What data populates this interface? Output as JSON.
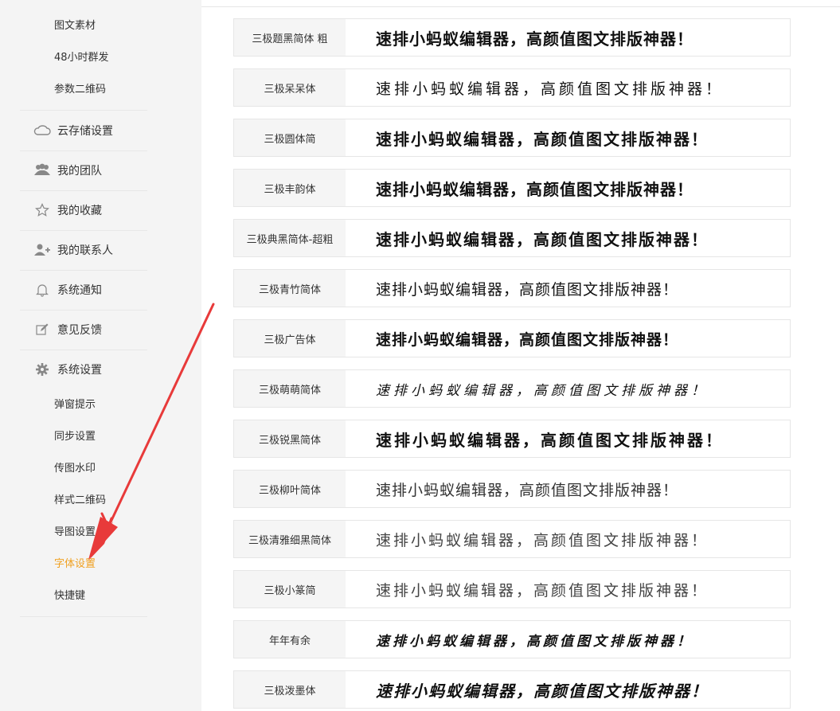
{
  "sidebar": {
    "sub_top": [
      "图文素材",
      "48小时群发",
      "参数二维码"
    ],
    "menu": [
      {
        "label": "云存储设置",
        "icon": "cloud-icon"
      },
      {
        "label": "我的团队",
        "icon": "team-icon"
      },
      {
        "label": "我的收藏",
        "icon": "star-icon"
      },
      {
        "label": "我的联系人",
        "icon": "add-contact-icon"
      },
      {
        "label": "系统通知",
        "icon": "bell-icon"
      },
      {
        "label": "意见反馈",
        "icon": "edit-icon"
      },
      {
        "label": "系统设置",
        "icon": "gear-icon"
      }
    ],
    "settings_items": [
      "弹窗提示",
      "同步设置",
      "传图水印",
      "样式二维码",
      "导图设置",
      "字体设置",
      "快捷键"
    ],
    "active_item": "字体设置"
  },
  "fonts": [
    {
      "name": "三极题黑简体 粗",
      "sample": "速排小蚂蚁编辑器，高颜值图文排版神器！"
    },
    {
      "name": "三极呆呆体",
      "sample": "速排小蚂蚁编辑器，高颜值图文排版神器！"
    },
    {
      "name": "三极圆体简",
      "sample": "速排小蚂蚁编辑器，高颜值图文排版神器！"
    },
    {
      "name": "三极丰韵体",
      "sample": "速排小蚂蚁编辑器，高颜值图文排版神器！"
    },
    {
      "name": "三极典黑简体-超粗",
      "sample": "速排小蚂蚁编辑器，高颜值图文排版神器！"
    },
    {
      "name": "三极青竹简体",
      "sample": "速排小蚂蚁编辑器，高颜值图文排版神器！"
    },
    {
      "name": "三极广告体",
      "sample": "速排小蚂蚁编辑器，高颜值图文排版神器！"
    },
    {
      "name": "三极萌萌简体",
      "sample": "速排小蚂蚁编辑器，高颜值图文排版神器！"
    },
    {
      "name": "三极锐黑简体",
      "sample": "速排小蚂蚁编辑器，高颜值图文排版神器！"
    },
    {
      "name": "三极柳叶简体",
      "sample": "速排小蚂蚁编辑器，高颜值图文排版神器！"
    },
    {
      "name": "三极清雅细黑简体",
      "sample": "速排小蚂蚁编辑器，高颜值图文排版神器！"
    },
    {
      "name": "三极小篆简",
      "sample": "速排小蚂蚁编辑器，高颜值图文排版神器！"
    },
    {
      "name": "年年有余",
      "sample": "速排小蚂蚁编辑器，高颜值图文排版神器！"
    },
    {
      "name": "三极泼墨体",
      "sample": "速排小蚂蚁编辑器，高颜值图文排版神器！"
    }
  ],
  "colors": {
    "active_item": "#f0a020",
    "annotation_arrow": "#e83a3a"
  }
}
